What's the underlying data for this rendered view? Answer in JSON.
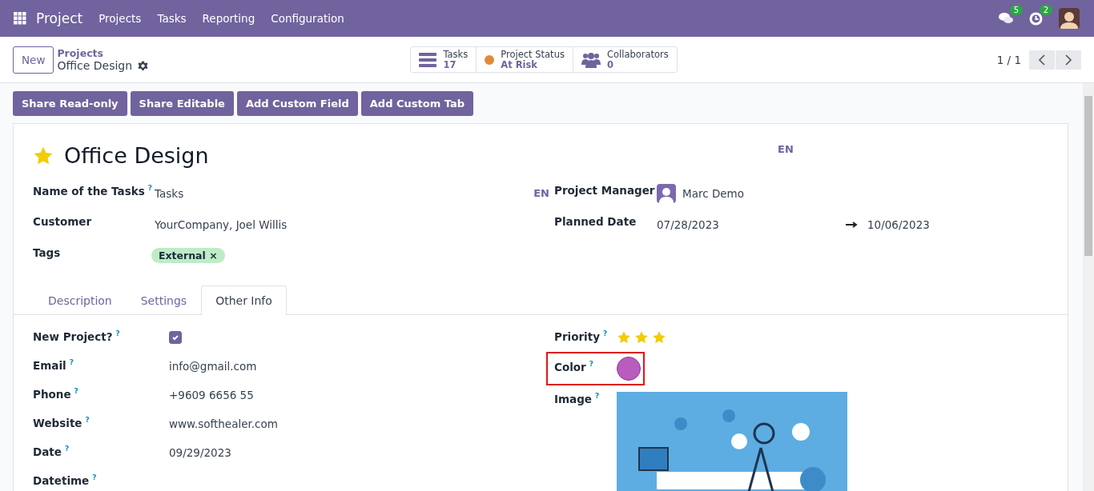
{
  "navbar": {
    "app": "Project",
    "menu": [
      "Projects",
      "Tasks",
      "Reporting",
      "Configuration"
    ],
    "messages_badge": "5",
    "activities_badge": "2"
  },
  "control_panel": {
    "new_button": "New",
    "breadcrumb_parent": "Projects",
    "breadcrumb_current": "Office Design",
    "smart_buttons": [
      {
        "kind": "tasks",
        "label": "Tasks",
        "value": "17"
      },
      {
        "kind": "status",
        "label": "Project Status",
        "value": "At Risk",
        "color": "#e08a36"
      },
      {
        "kind": "collaborators",
        "label": "Collaborators",
        "value": "0"
      }
    ],
    "pager": "1 / 1"
  },
  "action_buttons": [
    "Share Read-only",
    "Share Editable",
    "Add Custom Field",
    "Add Custom Tab"
  ],
  "form": {
    "favorite": true,
    "title": "Office Design",
    "title_lang": "EN",
    "left_fields": [
      {
        "kind": "text",
        "label": "Name of the Tasks",
        "help": "?",
        "value": "Tasks",
        "lang": "EN"
      },
      {
        "kind": "text",
        "label": "Customer",
        "value": "YourCompany, Joel Willis"
      },
      {
        "kind": "tags",
        "label": "Tags",
        "tags": [
          {
            "label": "External",
            "remove": "×"
          }
        ]
      }
    ],
    "right_fields": [
      {
        "kind": "user",
        "label": "Project Manager",
        "value": "Marc Demo"
      },
      {
        "kind": "daterange",
        "label": "Planned Date",
        "start": "07/28/2023",
        "end": "10/06/2023"
      }
    ],
    "tabs": [
      {
        "label": "Description",
        "selected": false
      },
      {
        "label": "Settings",
        "selected": false
      },
      {
        "label": "Other Info",
        "selected": true
      }
    ],
    "other_left": [
      {
        "kind": "checkbox",
        "label": "New Project?",
        "help": "?",
        "checked": true
      },
      {
        "kind": "text",
        "label": "Email",
        "help": "?",
        "value": "info@gmail.com"
      },
      {
        "kind": "text",
        "label": "Phone",
        "help": "?",
        "value": "+9609 6656 55"
      },
      {
        "kind": "text",
        "label": "Website",
        "help": "?",
        "value": "www.softhealer.com"
      },
      {
        "kind": "text",
        "label": "Date",
        "help": "?",
        "value": "09/29/2023"
      },
      {
        "kind": "text",
        "label": "Datetime",
        "help": "?"
      }
    ],
    "other_right": [
      {
        "kind": "priority",
        "label": "Priority",
        "help": "?",
        "stars": 3
      },
      {
        "kind": "color",
        "label": "Color",
        "help": "?",
        "color": "#b95cbd",
        "highlighted": true
      },
      {
        "label": "Image",
        "help": "?"
      }
    ]
  }
}
